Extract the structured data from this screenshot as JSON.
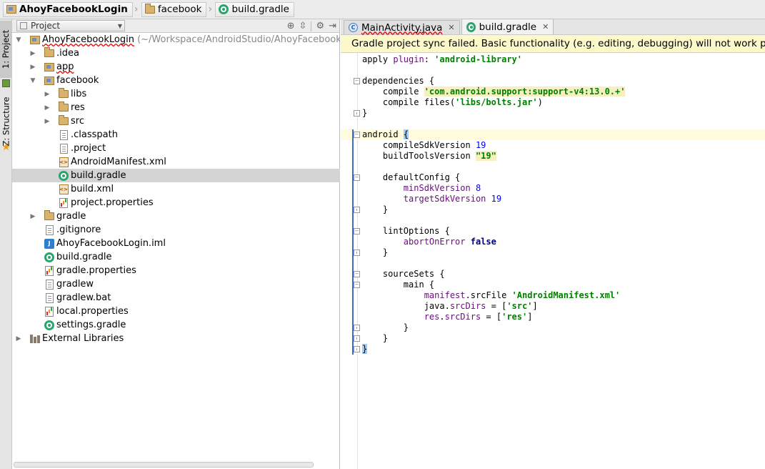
{
  "breadcrumbs": [
    {
      "label": "AhoyFacebookLogin",
      "icon": "module-icon",
      "bold": true
    },
    {
      "label": "facebook",
      "icon": "folder-icon",
      "bold": false
    },
    {
      "label": "build.gradle",
      "icon": "gradle-icon",
      "bold": false
    }
  ],
  "stripe": {
    "project_label": "1: Project",
    "structure_label": "Z: Structure"
  },
  "project_panel": {
    "view_mode": "Project",
    "tree": [
      {
        "depth": 0,
        "label": "AhoyFacebookLogin",
        "path": " (~/Workspace/AndroidStudio/AhoyFacebookLo",
        "icon": "module",
        "arrow": "open",
        "error": true
      },
      {
        "depth": 1,
        "label": ".idea",
        "icon": "folder",
        "arrow": "closed"
      },
      {
        "depth": 1,
        "label": "app",
        "icon": "module",
        "arrow": "closed",
        "error": true
      },
      {
        "depth": 1,
        "label": "facebook",
        "icon": "module",
        "arrow": "open"
      },
      {
        "depth": 2,
        "label": "libs",
        "icon": "folder",
        "arrow": "closed"
      },
      {
        "depth": 2,
        "label": "res",
        "icon": "folder",
        "arrow": "closed"
      },
      {
        "depth": 2,
        "label": "src",
        "icon": "folder",
        "arrow": "closed"
      },
      {
        "depth": 2,
        "label": ".classpath",
        "icon": "file",
        "arrow": "none"
      },
      {
        "depth": 2,
        "label": ".project",
        "icon": "file",
        "arrow": "none"
      },
      {
        "depth": 2,
        "label": "AndroidManifest.xml",
        "icon": "xml",
        "arrow": "none"
      },
      {
        "depth": 2,
        "label": "build.gradle",
        "icon": "gradle",
        "arrow": "none",
        "selected": true
      },
      {
        "depth": 2,
        "label": "build.xml",
        "icon": "xml",
        "arrow": "none"
      },
      {
        "depth": 2,
        "label": "project.properties",
        "icon": "props",
        "arrow": "none"
      },
      {
        "depth": 1,
        "label": "gradle",
        "icon": "folder",
        "arrow": "closed"
      },
      {
        "depth": 1,
        "label": ".gitignore",
        "icon": "file",
        "arrow": "none"
      },
      {
        "depth": 1,
        "label": "AhoyFacebookLogin.iml",
        "icon": "iml",
        "arrow": "none"
      },
      {
        "depth": 1,
        "label": "build.gradle",
        "icon": "gradle",
        "arrow": "none"
      },
      {
        "depth": 1,
        "label": "gradle.properties",
        "icon": "props",
        "arrow": "none"
      },
      {
        "depth": 1,
        "label": "gradlew",
        "icon": "file",
        "arrow": "none"
      },
      {
        "depth": 1,
        "label": "gradlew.bat",
        "icon": "file",
        "arrow": "none"
      },
      {
        "depth": 1,
        "label": "local.properties",
        "icon": "props",
        "arrow": "none"
      },
      {
        "depth": 1,
        "label": "settings.gradle",
        "icon": "gradle",
        "arrow": "none"
      },
      {
        "depth": 0,
        "label": "External Libraries",
        "icon": "libs",
        "arrow": "closed"
      }
    ]
  },
  "editor": {
    "tabs": [
      {
        "label": "MainActivity.java",
        "icon": "java-class-icon",
        "active": false,
        "error": true
      },
      {
        "label": "build.gradle",
        "icon": "gradle-icon",
        "active": true,
        "error": false
      }
    ],
    "banner": "Gradle project sync failed. Basic functionality (e.g. editing, debugging) will not work properly.",
    "code_lines": [
      [
        {
          "t": "apply ",
          "c": "plain"
        },
        {
          "t": "plugin",
          "c": "prop"
        },
        {
          "t": ": ",
          "c": "plain"
        },
        {
          "t": "'android-library'",
          "c": "str"
        }
      ],
      [],
      [
        {
          "t": "dependencies {",
          "c": "plain"
        }
      ],
      [
        {
          "t": "    compile ",
          "c": "plain"
        },
        {
          "t": "'com.android.support:support-v4:13.0.+'",
          "c": "strhl"
        }
      ],
      [
        {
          "t": "    compile files(",
          "c": "plain"
        },
        {
          "t": "'libs/bolts.jar'",
          "c": "str"
        },
        {
          "t": ")",
          "c": "plain"
        }
      ],
      [
        {
          "t": "}",
          "c": "plain"
        }
      ],
      [],
      [
        {
          "t": "android ",
          "c": "plain"
        },
        {
          "t": "{",
          "c": "bracehl"
        }
      ],
      [
        {
          "t": "    compileSdkVersion ",
          "c": "plain"
        },
        {
          "t": "19",
          "c": "num"
        }
      ],
      [
        {
          "t": "    buildToolsVersion ",
          "c": "plain"
        },
        {
          "t": "\"19\"",
          "c": "strhl"
        }
      ],
      [],
      [
        {
          "t": "    defaultConfig {",
          "c": "plain"
        }
      ],
      [
        {
          "t": "        ",
          "c": "plain"
        },
        {
          "t": "minSdkVersion",
          "c": "prop"
        },
        {
          "t": " ",
          "c": "plain"
        },
        {
          "t": "8",
          "c": "num"
        }
      ],
      [
        {
          "t": "        ",
          "c": "plain"
        },
        {
          "t": "targetSdkVersion",
          "c": "prop"
        },
        {
          "t": " ",
          "c": "plain"
        },
        {
          "t": "19",
          "c": "num"
        }
      ],
      [
        {
          "t": "    }",
          "c": "plain"
        }
      ],
      [],
      [
        {
          "t": "    lintOptions {",
          "c": "plain"
        }
      ],
      [
        {
          "t": "        ",
          "c": "plain"
        },
        {
          "t": "abortOnError",
          "c": "prop"
        },
        {
          "t": " ",
          "c": "plain"
        },
        {
          "t": "false",
          "c": "kw"
        }
      ],
      [
        {
          "t": "    }",
          "c": "plain"
        }
      ],
      [],
      [
        {
          "t": "    sourceSets {",
          "c": "plain"
        }
      ],
      [
        {
          "t": "        main {",
          "c": "plain"
        }
      ],
      [
        {
          "t": "            ",
          "c": "plain"
        },
        {
          "t": "manifest",
          "c": "prop"
        },
        {
          "t": ".srcFile ",
          "c": "plain"
        },
        {
          "t": "'AndroidManifest.xml'",
          "c": "str"
        }
      ],
      [
        {
          "t": "            java.",
          "c": "plain"
        },
        {
          "t": "srcDirs",
          "c": "prop"
        },
        {
          "t": " = [",
          "c": "plain"
        },
        {
          "t": "'src'",
          "c": "str"
        },
        {
          "t": "]",
          "c": "plain"
        }
      ],
      [
        {
          "t": "            ",
          "c": "plain"
        },
        {
          "t": "res",
          "c": "prop"
        },
        {
          "t": ".",
          "c": "plain"
        },
        {
          "t": "srcDirs",
          "c": "prop"
        },
        {
          "t": " = [",
          "c": "plain"
        },
        {
          "t": "'res'",
          "c": "str"
        },
        {
          "t": "]",
          "c": "plain"
        }
      ],
      [
        {
          "t": "        }",
          "c": "plain"
        }
      ],
      [
        {
          "t": "    }",
          "c": "plain"
        }
      ],
      [
        {
          "t": "}",
          "c": "bracehl"
        }
      ]
    ],
    "current_line": 7
  }
}
